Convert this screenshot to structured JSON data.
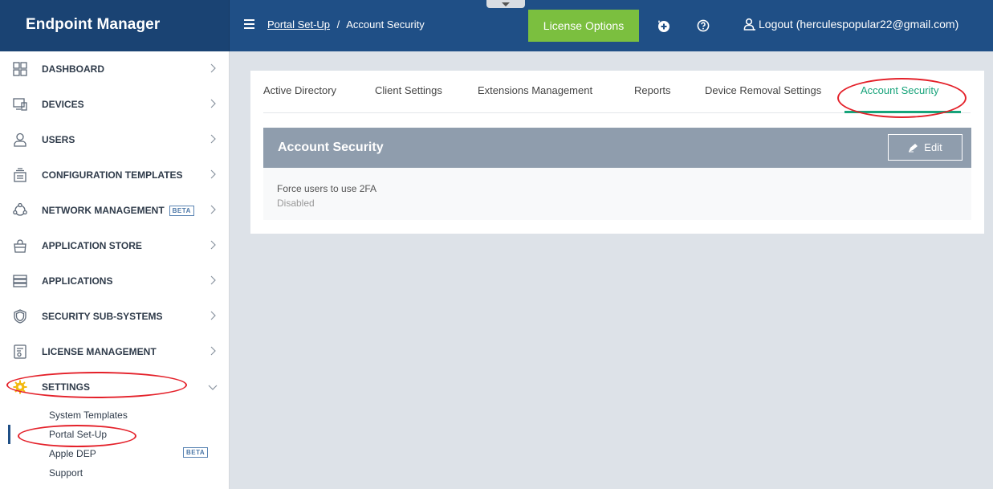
{
  "header": {
    "brand": "Endpoint Manager",
    "breadcrumb": {
      "parent": "Portal Set-Up",
      "separator": "/",
      "current": "Account Security"
    },
    "license_button": "License Options",
    "logout_label": "Logout (herculespopular22@gmail.com)",
    "icons": [
      "hamburger-menu-icon",
      "add-circle-icon",
      "help-circle-icon",
      "user-icon"
    ]
  },
  "sidebar": {
    "items": [
      {
        "label": "DASHBOARD",
        "icon": "dashboard-icon"
      },
      {
        "label": "DEVICES",
        "icon": "devices-icon"
      },
      {
        "label": "USERS",
        "icon": "users-icon"
      },
      {
        "label": "CONFIGURATION TEMPLATES",
        "icon": "templates-icon"
      },
      {
        "label": "NETWORK MANAGEMENT",
        "icon": "network-icon",
        "badge": "BETA"
      },
      {
        "label": "APPLICATION STORE",
        "icon": "store-icon"
      },
      {
        "label": "APPLICATIONS",
        "icon": "applications-icon"
      },
      {
        "label": "SECURITY SUB-SYSTEMS",
        "icon": "shield-icon"
      },
      {
        "label": "LICENSE MANAGEMENT",
        "icon": "license-icon"
      },
      {
        "label": "SETTINGS",
        "icon": "gear-icon",
        "expanded": true
      }
    ],
    "settings_sub": [
      {
        "label": "System Templates"
      },
      {
        "label": "Portal Set-Up",
        "active": true
      },
      {
        "label": "Apple DEP",
        "badge": "BETA"
      },
      {
        "label": "Support"
      }
    ]
  },
  "tabs": [
    {
      "label": "Active Directory"
    },
    {
      "label": "Client Settings"
    },
    {
      "label": "Extensions Management"
    },
    {
      "label": "Reports"
    },
    {
      "label": "Device Removal Settings"
    },
    {
      "label": "Account Security",
      "active": true
    }
  ],
  "section": {
    "title": "Account Security",
    "edit_label": "Edit",
    "field_label": "Force users to use 2FA",
    "field_value": "Disabled"
  },
  "colors": {
    "header_bg": "#1f4f86",
    "brand_bg": "#1a4373",
    "license_green": "#7bbf3f",
    "active_tab": "#17a37a",
    "section_head": "#8f9dad",
    "annotation_red": "#e4212a",
    "settings_icon": "#f2b90f"
  }
}
